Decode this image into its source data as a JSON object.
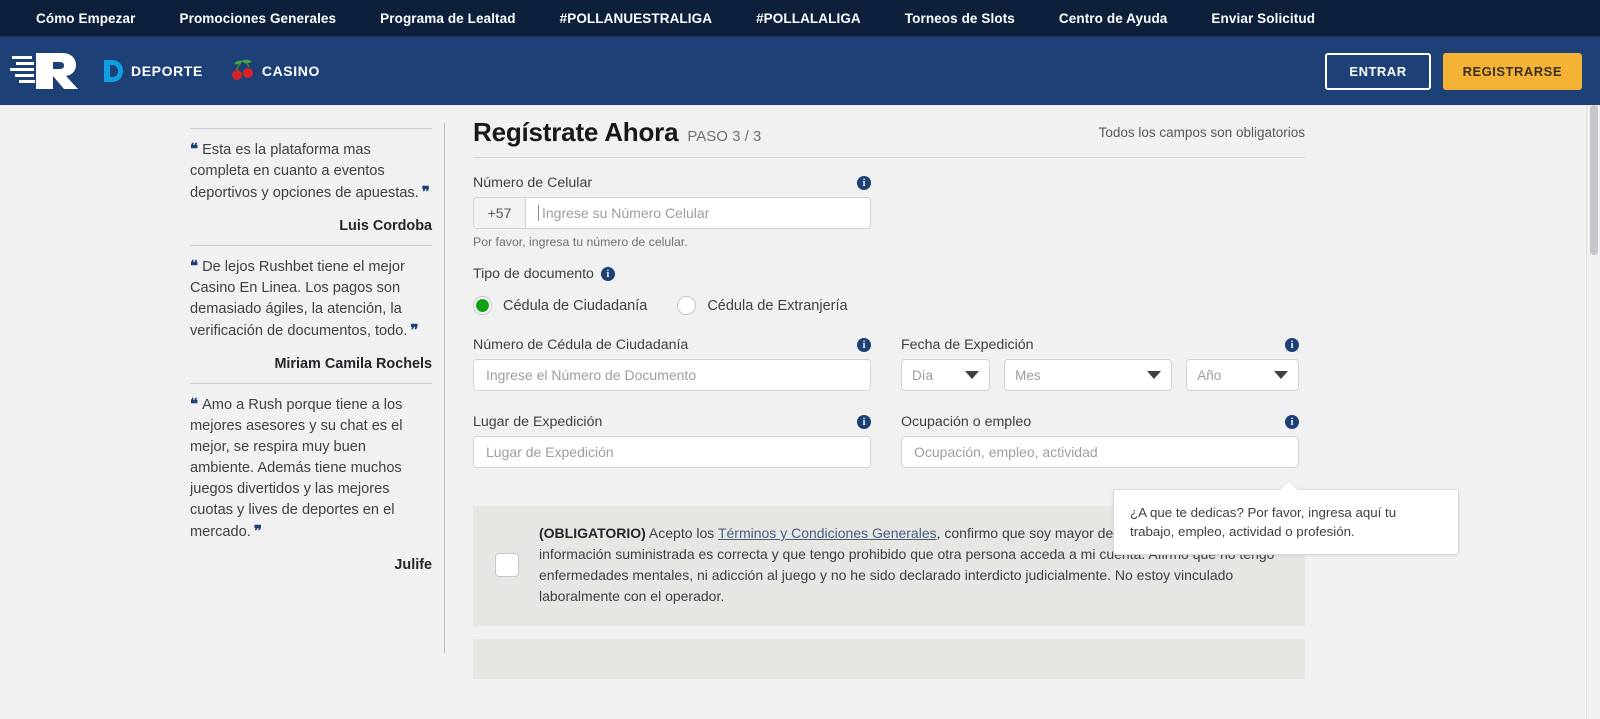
{
  "topnav": {
    "items": [
      {
        "label": "Cómo Empezar"
      },
      {
        "label": "Promociones Generales"
      },
      {
        "label": "Programa de Lealtad"
      },
      {
        "label": "#POLLANUESTRALIGA"
      },
      {
        "label": "#POLLALALIGA"
      },
      {
        "label": "Torneos de Slots"
      },
      {
        "label": "Centro de Ayuda"
      },
      {
        "label": "Enviar Solicitud"
      }
    ]
  },
  "header": {
    "logo_letter": "R",
    "deporte_label": "DEPORTE",
    "deporte_badge": "D",
    "casino_label": "CASINO",
    "entrar_label": "ENTRAR",
    "registrarse_label": "REGISTRARSE",
    "accent_blue": "#1d4077",
    "accent_yellow": "#f5b335",
    "topbar_navy": "#0e1f3c"
  },
  "testimonials": [
    {
      "text": "Esta es la plataforma mas completa en cuanto a eventos deportivos y opciones de apuestas.",
      "author": "Luis Cordoba"
    },
    {
      "text": "De lejos Rushbet tiene el mejor Casino En Linea. Los pagos son demasiado ágiles, la atención, la verificación de documentos, todo.",
      "author": "Miriam Camila Rochels"
    },
    {
      "text": "Amo a Rush porque tiene a los mejores asesores y su chat es el mejor, se respira muy buen ambiente. Además tiene muchos juegos divertidos y las mejores cuotas y lives de deportes en el mercado.",
      "author": "Julife"
    }
  ],
  "form": {
    "title": "Regístrate Ahora",
    "step": "PASO 3 / 3",
    "required_note": "Todos los campos son obligatorios",
    "phone": {
      "label": "Número de Celular",
      "prefix": "+57",
      "placeholder": "Ingrese su Número Celular",
      "value": "",
      "helper": "Por favor, ingresa tu número de celular."
    },
    "doc_type": {
      "label": "Tipo de documento",
      "options": [
        {
          "label": "Cédula de Ciudadanía",
          "selected": true
        },
        {
          "label": "Cédula de Extranjería",
          "selected": false
        }
      ],
      "selected_color": "#11a111"
    },
    "doc_number": {
      "label": "Número de Cédula de Ciudadanía",
      "placeholder": "Ingrese el Número de Documento",
      "value": ""
    },
    "expedition_date": {
      "label": "Fecha de Expedición",
      "day": "Día",
      "month": "Mes",
      "year": "Año"
    },
    "expedition_place": {
      "label": "Lugar de Expedición",
      "placeholder": "Lugar de Expedición",
      "value": ""
    },
    "occupation": {
      "label": "Ocupación o empleo",
      "placeholder": "Ocupación, empleo, actividad",
      "value": ""
    },
    "tooltip": {
      "text": "¿A que te dedicas? Por favor, ingresa aquí tu trabajo, empleo, actividad o profesión."
    },
    "terms": {
      "mandatory": "(OBLIGATORIO)",
      "before_link": " Acepto los ",
      "link": "Términos y Condiciones Generales",
      "after_link": ", confirmo que soy mayor de 18 años, que la información suministrada es correcta y que tengo prohibido que otra persona acceda a mi cuenta. Afirmo que no tengo enfermedades mentales, ni adicción al juego y no he sido declarado interdicto judicialmente. No estoy vinculado laboralmente con el operador.",
      "checked": false
    }
  }
}
